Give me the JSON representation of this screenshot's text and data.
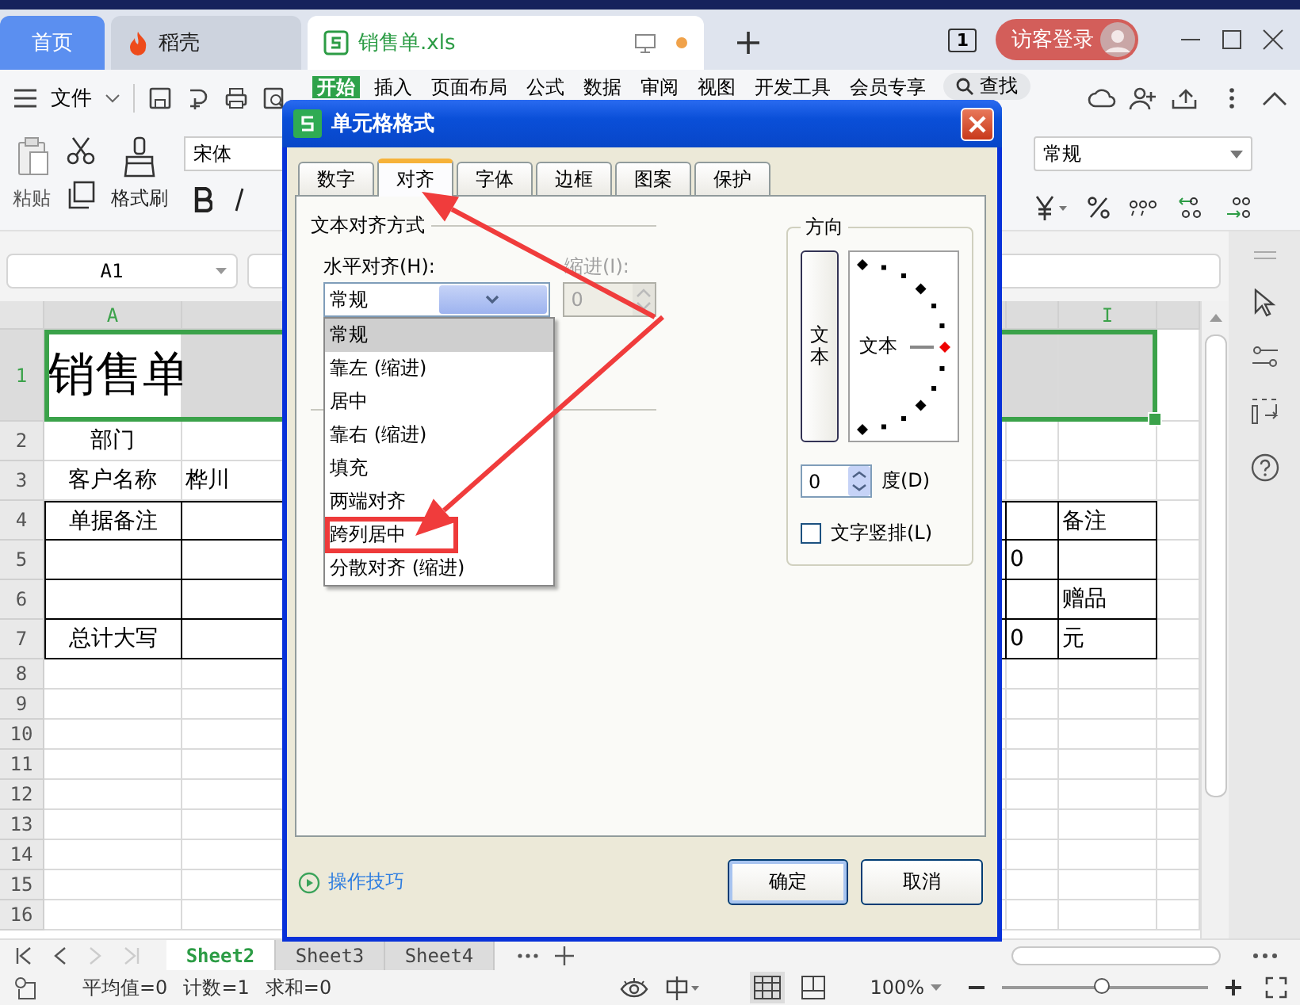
{
  "title_bar": {
    "tabs": [
      {
        "kind": "home",
        "label": "首页",
        "selected": false
      },
      {
        "kind": "docer",
        "label": "稻壳",
        "selected": false
      },
      {
        "kind": "workbook",
        "label": "销售单.xls",
        "selected": true,
        "unsaved": true
      }
    ],
    "window_badge": "1",
    "login_button": "访客登录"
  },
  "menu_bar": {
    "file_menu": "文件",
    "tabs": [
      {
        "label": "开始",
        "selected": true
      },
      {
        "label": "插入",
        "selected": false
      },
      {
        "label": "页面布局",
        "selected": false
      },
      {
        "label": "公式",
        "selected": false
      },
      {
        "label": "数据",
        "selected": false
      },
      {
        "label": "审阅",
        "selected": false
      },
      {
        "label": "视图",
        "selected": false
      },
      {
        "label": "开发工具",
        "selected": false
      },
      {
        "label": "会员专享",
        "selected": false
      }
    ],
    "search": "查找"
  },
  "ribbon": {
    "paste": "粘贴",
    "format_painter": "格式刷",
    "font_name": "宋体",
    "number_format": "常规"
  },
  "name_box": "A1",
  "sheet": {
    "column_headers": {
      "column_a": "A",
      "column_i": "I"
    },
    "rows": [
      {
        "number": "1",
        "kind": "title",
        "selected": true,
        "boxed": false,
        "column_a": "销售单"
      },
      {
        "number": "2",
        "kind": "data",
        "selected": false,
        "boxed": false,
        "column_a": "部门"
      },
      {
        "number": "3",
        "kind": "data",
        "selected": false,
        "boxed": false,
        "column_a": "客户名称",
        "column_b": "桦川"
      },
      {
        "number": "4",
        "kind": "data",
        "selected": false,
        "boxed": true,
        "column_a": "单据备注",
        "column_i": "备注"
      },
      {
        "number": "5",
        "kind": "data",
        "selected": false,
        "boxed": true,
        "column_h": "0"
      },
      {
        "number": "6",
        "kind": "data",
        "selected": false,
        "boxed": true,
        "column_i": "赠品"
      },
      {
        "number": "7",
        "kind": "data",
        "selected": false,
        "boxed": true,
        "column_a": "总计大写",
        "column_h": "0",
        "column_i": "元"
      },
      {
        "number": "8",
        "kind": "data",
        "selected": false,
        "boxed": false
      },
      {
        "number": "9",
        "kind": "data",
        "selected": false,
        "boxed": false
      },
      {
        "number": "10",
        "kind": "data",
        "selected": false,
        "boxed": false
      },
      {
        "number": "11",
        "kind": "data",
        "selected": false,
        "boxed": false
      },
      {
        "number": "12",
        "kind": "data",
        "selected": false,
        "boxed": false
      },
      {
        "number": "13",
        "kind": "data",
        "selected": false,
        "boxed": false
      },
      {
        "number": "14",
        "kind": "data",
        "selected": false,
        "boxed": false
      },
      {
        "number": "15",
        "kind": "data",
        "selected": false,
        "boxed": false
      },
      {
        "number": "16",
        "kind": "data",
        "selected": false,
        "boxed": false
      }
    ]
  },
  "dialog": {
    "title": "单元格格式",
    "tabs": [
      {
        "label": "数字",
        "selected": false
      },
      {
        "label": "对齐",
        "selected": true
      },
      {
        "label": "字体",
        "selected": false
      },
      {
        "label": "边框",
        "selected": false
      },
      {
        "label": "图案",
        "selected": false
      },
      {
        "label": "保护",
        "selected": false
      }
    ],
    "text_alignment": {
      "group_label": "文本对齐方式",
      "horizontal_label": "水平对齐(H):",
      "horizontal_value": "常规",
      "indent_label": "缩进(I):",
      "indent_value": "0",
      "indent_disabled": true,
      "dropdown_open": true,
      "options": [
        {
          "label": "常规",
          "selected": true,
          "highlighted": false
        },
        {
          "label": "靠左 (缩进)",
          "selected": false,
          "highlighted": false
        },
        {
          "label": "居中",
          "selected": false,
          "highlighted": false
        },
        {
          "label": "靠右 (缩进)",
          "selected": false,
          "highlighted": false
        },
        {
          "label": "填充",
          "selected": false,
          "highlighted": false
        },
        {
          "label": "两端对齐",
          "selected": false,
          "highlighted": false
        },
        {
          "label": "跨列居中",
          "selected": false,
          "highlighted": true
        },
        {
          "label": "分散对齐 (缩进)",
          "selected": false,
          "highlighted": false
        }
      ]
    },
    "orientation": {
      "group_label": "方向",
      "vertical_text_button": "文本",
      "dial_label": "文本",
      "degrees_value": "0",
      "degrees_label": "度(D)",
      "vertical_checkbox": {
        "label": "文字竖排(L)",
        "checked": false
      }
    },
    "tips_link": "操作技巧",
    "ok_button": "确定",
    "cancel_button": "取消"
  },
  "sheet_tabs": [
    {
      "label": "Sheet2",
      "selected": true
    },
    {
      "label": "Sheet3",
      "selected": false
    },
    {
      "label": "Sheet4",
      "selected": false
    }
  ],
  "status_bar": {
    "average": "平均值=0",
    "count": "计数=1",
    "sum": "求和=0",
    "zoom": "100%",
    "zoom_slider": {
      "level": 0.49
    }
  }
}
